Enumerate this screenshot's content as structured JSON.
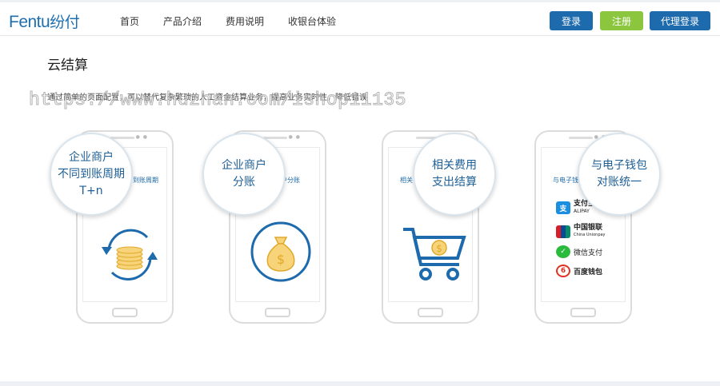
{
  "header": {
    "logo_text": "Fentu",
    "logo_cn": "纷付",
    "nav": [
      "首页",
      "产品介绍",
      "费用说明",
      "收银台体验"
    ],
    "login_label": "登录",
    "register_label": "注册",
    "agent_login_label": "代理登录"
  },
  "main": {
    "title": "云结算",
    "description": "通过简单的页面配置，可以替代复杂繁琐的人工资金结算业务，提高业务实时性，降低错误",
    "watermark": "https://www.huzhan.com/ishop11135"
  },
  "cards": [
    {
      "bubble_lines": [
        "企业商户",
        "不同到账周期",
        "T+n"
      ],
      "screen_label": "到账周期",
      "icon": "refresh-coins-icon"
    },
    {
      "bubble_lines": [
        "企业商户",
        "分账"
      ],
      "screen_label": "户分账",
      "icon": "money-bag-icon"
    },
    {
      "bubble_lines": [
        "相关费用",
        "支出结算"
      ],
      "screen_label": "相关",
      "icon": "shopping-cart-icon"
    },
    {
      "bubble_lines": [
        "与电子钱包",
        "对账统一"
      ],
      "screen_label": "与电子钱",
      "icon": "wallet-list-icon"
    }
  ],
  "payments": [
    {
      "name": "支付宝",
      "sub": "ALIPAY",
      "icon": "alipay-icon",
      "color": "#1a8fe0"
    },
    {
      "name": "中国银联",
      "sub": "China Unionpay",
      "icon": "unionpay-icon",
      "color": "#d71e28"
    },
    {
      "name": "微信支付",
      "sub": "",
      "icon": "wechat-pay-icon",
      "color": "#2bbb3c"
    },
    {
      "name": "百度钱包",
      "sub": "",
      "icon": "baidu-wallet-icon",
      "color": "#e0301e"
    }
  ],
  "colors": {
    "primary": "#1d6aad",
    "accent_green": "#8cc63f",
    "bubble_text": "#1e5f96"
  }
}
